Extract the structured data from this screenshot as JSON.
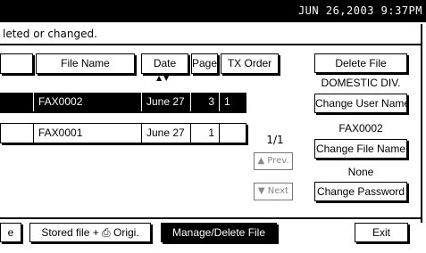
{
  "header": {
    "datetime": "JUN  26,2003  9:37PM"
  },
  "message": "leted or changed.",
  "table": {
    "columns": {
      "left_stub": "",
      "file_name": "File Name",
      "date": "Date",
      "page": "Page",
      "tx_order": "TX Order"
    },
    "sort_arrows": "▲▼",
    "rows": [
      {
        "file_name": "FAX0002",
        "date": "June  27",
        "page": "3",
        "tx_order": "1",
        "selected": true
      },
      {
        "file_name": "FAX0001",
        "date": "June  27",
        "page": "1",
        "tx_order": "",
        "selected": false
      }
    ]
  },
  "pager": {
    "page_indicator": "1/1",
    "prev_label": "▲ Prev.",
    "next_label": "▼ Next"
  },
  "side_panel": {
    "delete_file": "Delete File",
    "user_name": "DOMESTIC DIV.",
    "change_user_name": "Change User Name",
    "file_name": "FAX0002",
    "change_file_name": "Change File Name",
    "password": "None",
    "change_password": "Change Password"
  },
  "bottom": {
    "left_tab": "e",
    "stored_file_tab": "Stored file + ⎙ Origi.",
    "manage_delete_tab": "Manage/Delete File",
    "exit": "Exit"
  }
}
